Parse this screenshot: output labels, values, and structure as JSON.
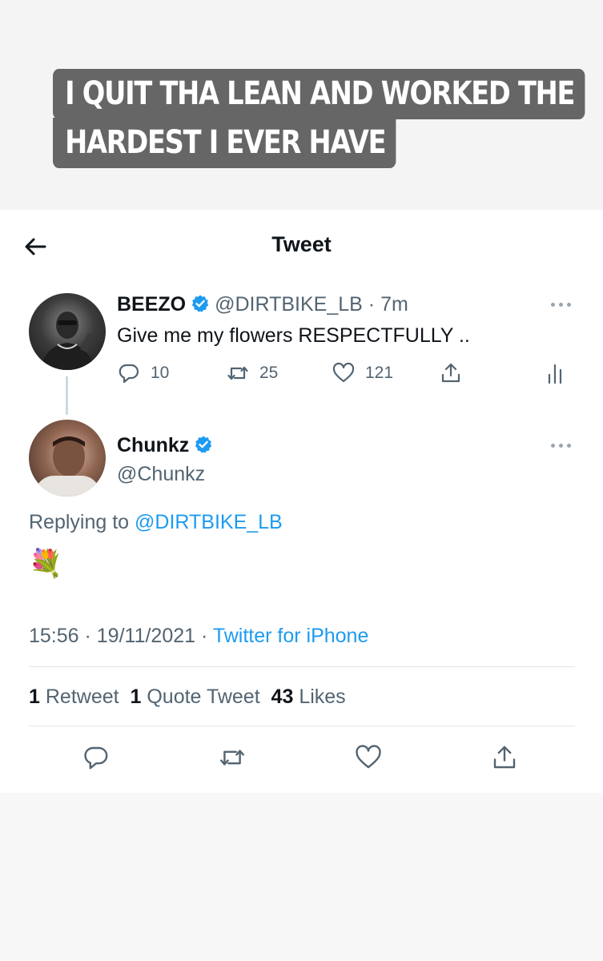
{
  "story": {
    "caption_line1": "I QUIT THA LEAN AND WORKED THE",
    "caption_line2": "HARDEST I EVER HAVE"
  },
  "header": {
    "title": "Tweet",
    "back_icon": "arrow-left-icon"
  },
  "parent_tweet": {
    "author_name": "BEEZO",
    "handle": "@DIRTBIKE_LB",
    "time": "7m",
    "text": "Give me my flowers RESPECTFULLY ..",
    "replies": "10",
    "retweets": "25",
    "likes": "121"
  },
  "main_tweet": {
    "author_name": "Chunkz",
    "handle": "@Chunkz",
    "replying_prefix": "Replying to",
    "replying_to": "@DIRTBIKE_LB",
    "emoji": "💐",
    "time": "15:56",
    "date": "19/11/2021",
    "source": "Twitter for iPhone",
    "retweet_count": "1",
    "retweet_label": "Retweet",
    "quote_count": "1",
    "quote_label": "Quote Tweet",
    "like_count": "43",
    "like_label": "Likes"
  },
  "colors": {
    "accent": "#1d9bf0",
    "secondary_text": "#536471",
    "caption_bg": "#666666"
  }
}
